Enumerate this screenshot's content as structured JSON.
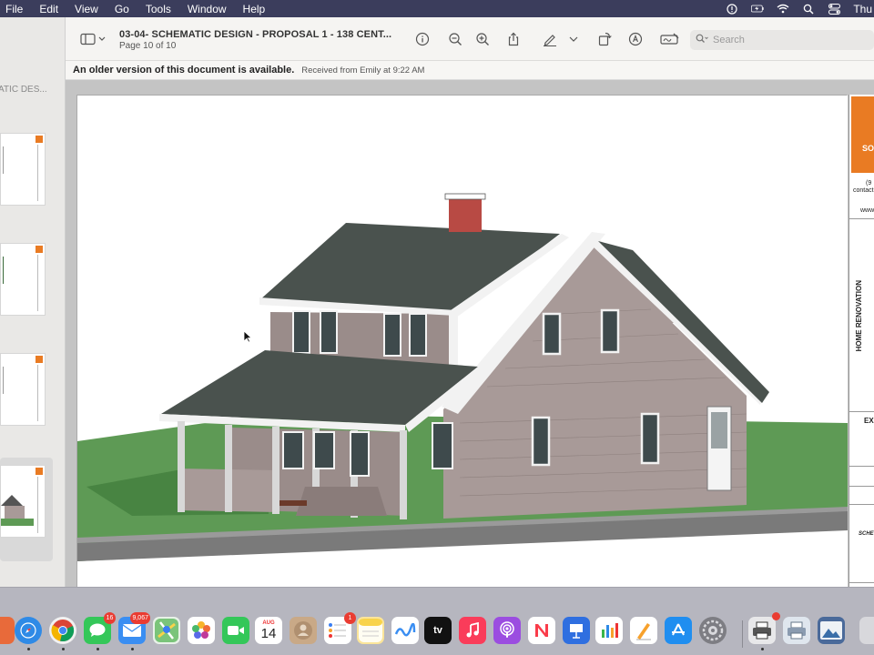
{
  "menubar": {
    "items": [
      "File",
      "Edit",
      "View",
      "Go",
      "Tools",
      "Window",
      "Help"
    ],
    "clock": "Thu"
  },
  "sidebar": {
    "title": "ATIC DES..."
  },
  "toolbar": {
    "doc_title": "03-04- SCHEMATIC DESIGN - PROPOSAL 1 - 138 CENT...",
    "page_info": "Page 10 of 10",
    "search_placeholder": "Search"
  },
  "notice": {
    "message": "An older version of this document is available.",
    "detail": "Received from Emily at 9:22 AM"
  },
  "titleblock": {
    "sc": "SO",
    "contact_a": "(9",
    "contact_b": "contact",
    "web": "www",
    "project": "HOME RENOVATION",
    "ex": "EX",
    "sche": "SCHE"
  },
  "dock": {
    "mail_badge": "9,067",
    "messages_badge": "16",
    "calendar_month": "AUG",
    "calendar_day": "14",
    "reminders_badge": "1",
    "tv_label": "tv"
  },
  "colors": {
    "menubar": "#3b3d5c",
    "accent_orange": "#e97b23",
    "roof": "#4a524e",
    "siding": "#a89a98",
    "grass": "#5e9a55"
  }
}
